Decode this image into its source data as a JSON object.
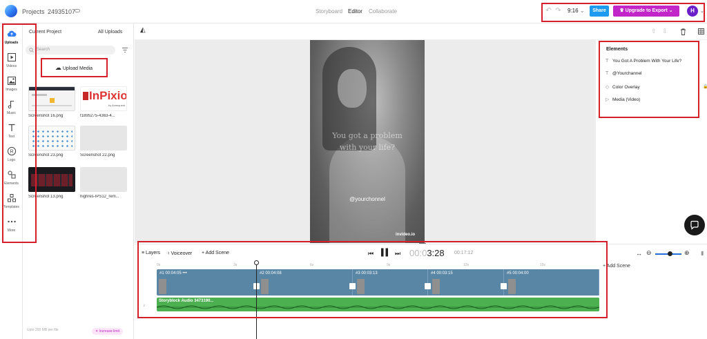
{
  "topbar": {
    "projects_label": "Projects",
    "project_id": "24935107",
    "modes": [
      "Storyboard",
      "Editor",
      "Collaborate"
    ],
    "aspect_ratio": "9:16",
    "share_label": "Share",
    "upgrade_label": "Upgrade to Export",
    "avatar_initial": "H"
  },
  "leftnav": {
    "items": [
      {
        "label": "Uploads",
        "icon": "upload-cloud-icon"
      },
      {
        "label": "Videos",
        "icon": "video-icon"
      },
      {
        "label": "Images",
        "icon": "image-icon"
      },
      {
        "label": "Music",
        "icon": "music-note-icon"
      },
      {
        "label": "Text",
        "icon": "text-icon"
      },
      {
        "label": "Logo",
        "icon": "registered-icon"
      },
      {
        "label": "Elements",
        "icon": "shapes-icon"
      },
      {
        "label": "Templates",
        "icon": "templates-icon"
      },
      {
        "label": "More",
        "icon": "more-dots-icon"
      }
    ]
  },
  "panel": {
    "tab_current": "Current Project",
    "tab_all": "All Uploads",
    "search_placeholder": "Search",
    "upload_media_label": "Upload Media",
    "files": [
      {
        "name": "Screenshot 16.png"
      },
      {
        "name": "f1895275-4363-4..."
      },
      {
        "name": "Screenshot 23.png"
      },
      {
        "name": "Screenshot 22.png"
      },
      {
        "name": "Screenshot 13.png"
      },
      {
        "name": "highres-IPS12_rem..."
      }
    ],
    "inpixio_logo_text": "InPixio",
    "inpixio_sub": "by Avanquest",
    "footer_text": "Upto 200 MB per file",
    "increase_limit_label": "Increase limit"
  },
  "preview": {
    "overlay_line1": "You got a problem",
    "overlay_line2": "with your life?",
    "handle": "@yourchonnel",
    "watermark": "invideo.io"
  },
  "elements_panel": {
    "title": "Elements",
    "items": [
      {
        "label": "You Got A Problem With Your Life?",
        "icon": "text-icon"
      },
      {
        "label": "@Yourchannel",
        "icon": "text-icon"
      },
      {
        "label": "Color Overlay",
        "icon": "diamond-icon"
      },
      {
        "label": "Media (Video)",
        "icon": "play-icon"
      }
    ]
  },
  "timeline": {
    "layers_label": "Layers",
    "voiceover_label": "Voiceover",
    "add_scene_label": "Add Scene",
    "time_current_dim": "00:0",
    "time_current": "3:28",
    "time_total": "00:17:12",
    "ruler_ticks": [
      "0s",
      "3s",
      "6s",
      "9s",
      "12s",
      "15s"
    ],
    "scenes": [
      {
        "num": "#1",
        "duration": "00:04:05",
        "more": "•••"
      },
      {
        "num": "#2",
        "duration": "00:04:08"
      },
      {
        "num": "#3",
        "duration": "00:03:13"
      },
      {
        "num": "#4",
        "duration": "00:03:15"
      },
      {
        "num": "#5",
        "duration": "00:04:00"
      }
    ],
    "audio_label": "Storyblock Audio 3473190...",
    "add_scene_right": "Add Scene",
    "zoom_level": 0.55
  },
  "colors": {
    "accent_blue": "#1e9bf0",
    "upgrade_purple": "#c226c8",
    "avatar_purple": "#6b1fc9",
    "video_track": "#5a86a6",
    "audio_track": "#4caf50",
    "annotation_red": "#d41f2a"
  }
}
